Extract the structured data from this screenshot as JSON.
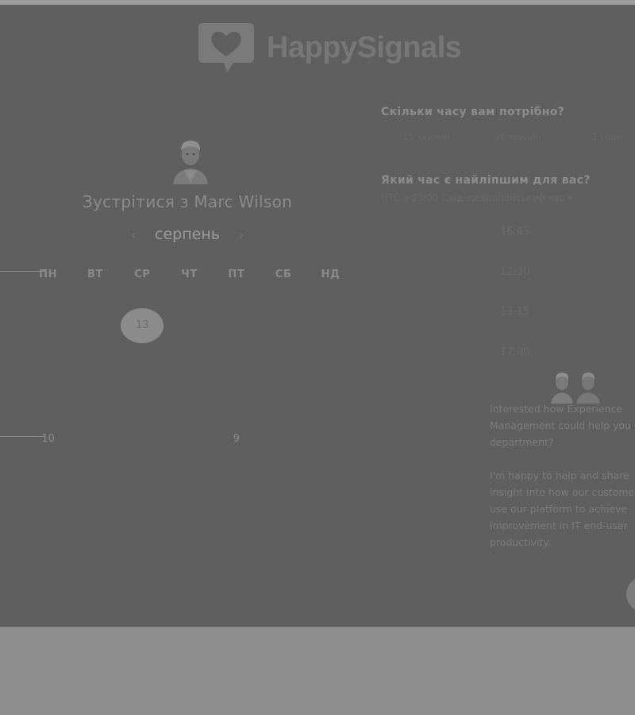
{
  "brand": {
    "name": "HappySignals",
    "logo_color": "#777777"
  },
  "booking": {
    "title_prefix": "Зустрітися з ",
    "host_name": "Marc Wilson",
    "month": "серпень",
    "prev_icon": "chevron-left-icon",
    "next_icon": "chevron-right-icon"
  },
  "calendar": {
    "weekdays": [
      "ПН",
      "ВТ",
      "СР",
      "ЧТ",
      "ПТ",
      "СБ",
      "НД"
    ],
    "selected_day": "13",
    "visible_days": {
      "row5_mon": "10",
      "row5_fri": "9"
    }
  },
  "duration": {
    "question": "Скільки часу вам потрібно?",
    "options": [
      "15 хвилин",
      "30 хвилин",
      "1 годи"
    ]
  },
  "time": {
    "question": "Який час є найліпшим для вас?",
    "timezone": "UTC +03:00 Східноєвропейський час ▾",
    "slots": [
      "16:45",
      "12:30",
      "13:15",
      "17:00"
    ]
  },
  "message": {
    "paragraph1": "Interested how Experience Management could help you department?",
    "paragraph2": "I'm happy to help and share insight into how our customers use our platform to achieve improvement in IT end-user productivity."
  },
  "colors": {
    "overlay": "#5f5f5f",
    "page_bg": "#8e8e8e",
    "selected_day_bg": "#8b8b8b"
  }
}
